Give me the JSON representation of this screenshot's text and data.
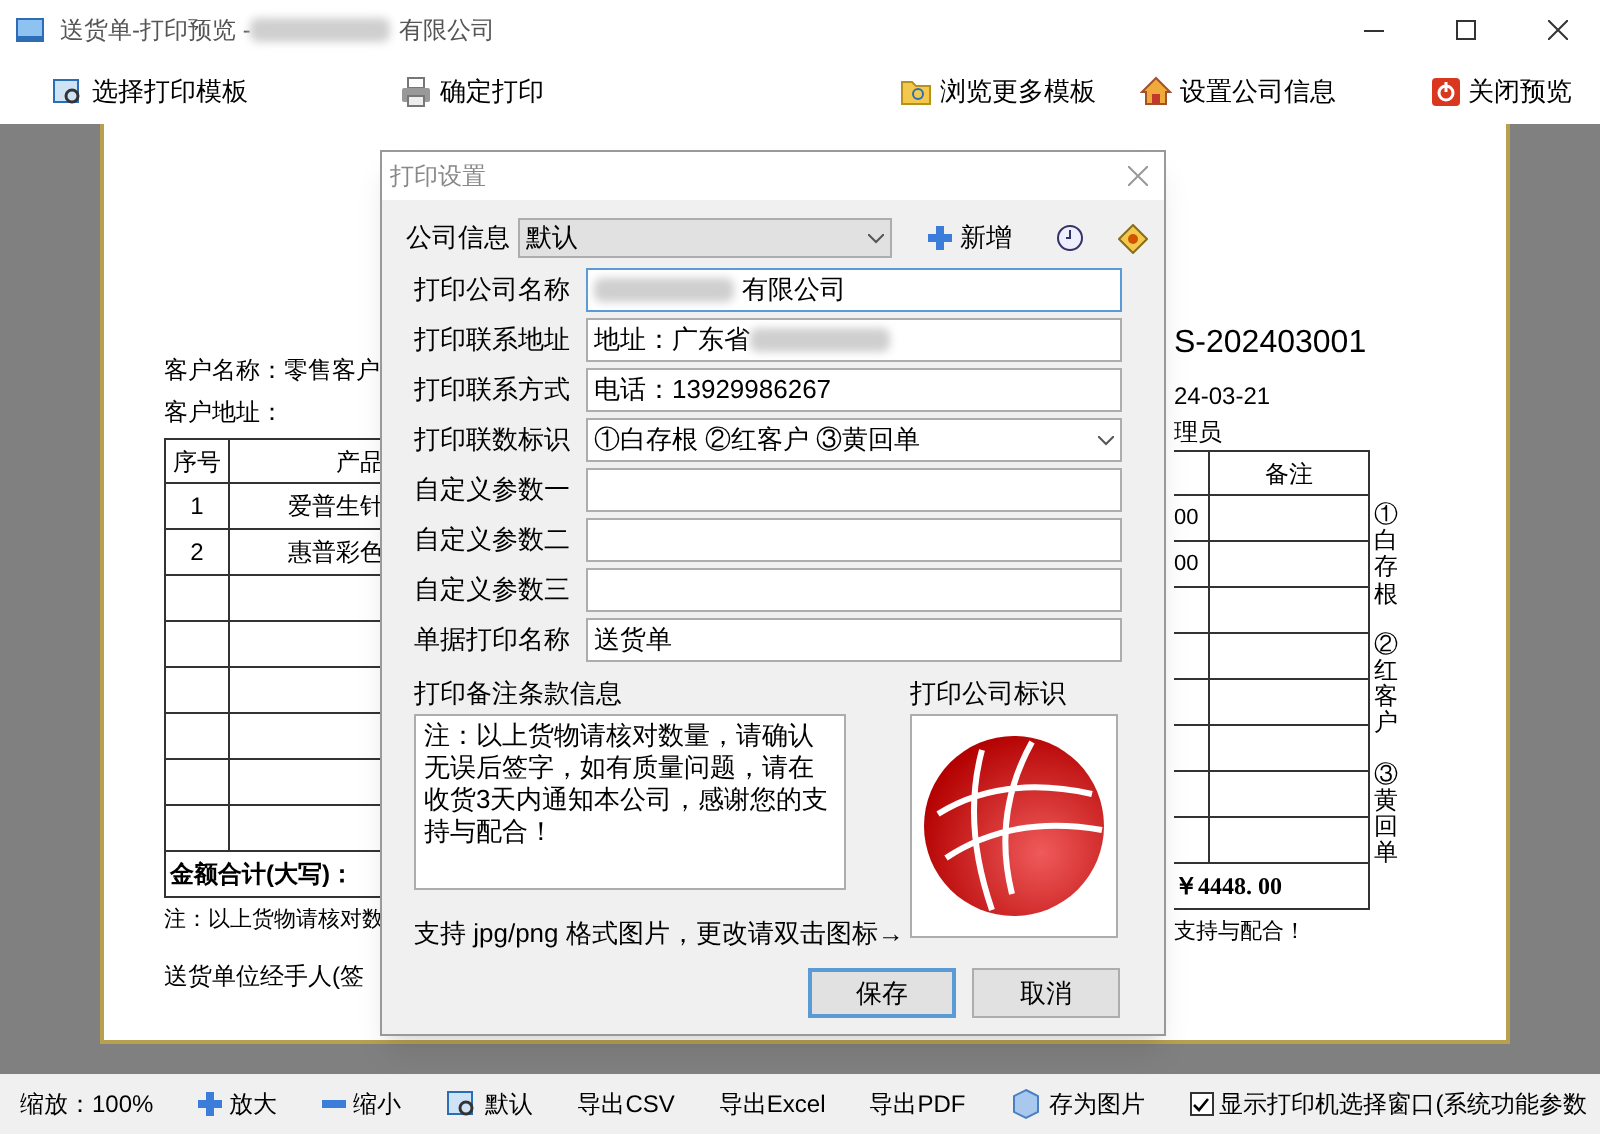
{
  "window": {
    "title": "送货单-打印预览 - ",
    "title_tail": "有限公司"
  },
  "toolbar": [
    {
      "label": "选择打印模板"
    },
    {
      "label": "确定打印"
    },
    {
      "label": "浏览更多模板"
    },
    {
      "label": "设置公司信息"
    },
    {
      "label": "关闭预览"
    }
  ],
  "paper": {
    "customer_name": "客户名称：零售客户",
    "customer_address": "客户地址：",
    "order_no": "S-202403001",
    "date": "24-03-21",
    "handler": "理员",
    "columns": [
      "序号",
      "产品",
      "备注"
    ],
    "rows": [
      {
        "no": "1",
        "product": "爱普生针",
        "amount": "00"
      },
      {
        "no": "2",
        "product": "惠普彩色",
        "amount": "00"
      },
      {},
      {},
      {},
      {},
      {},
      {}
    ],
    "total_label": "金额合计(大写)：",
    "total_value": "￥4448. 00",
    "note_left": "注：以上货物请核对数",
    "note_right": "支持与配合！",
    "signature": "送货单位经手人(签",
    "copies": [
      "①白存根",
      "②红客户",
      "③黄回单"
    ]
  },
  "dialog": {
    "title": "打印设置",
    "company_label": "公司信息",
    "company_select": "默认",
    "add_button": "新增",
    "fields": [
      {
        "label": "打印公司名称",
        "value": "有限公司",
        "blurred": true,
        "focused": true
      },
      {
        "label": "打印联系地址",
        "value": "地址：广东省",
        "blurred": true,
        "focused": false
      },
      {
        "label": "打印联系方式",
        "value": "电话：13929986267",
        "blurred": false,
        "focused": false
      },
      {
        "label": "打印联数标识",
        "value": "①白存根 ②红客户 ③黄回单",
        "blurred": false,
        "focused": false,
        "kind": "select"
      },
      {
        "label": "自定义参数一",
        "blurred": false,
        "focused": false
      },
      {
        "label": "自定义参数二",
        "blurred": false,
        "focused": false
      },
      {
        "label": "自定义参数三",
        "blurred": false,
        "focused": false
      },
      {
        "label": "单据打印名称",
        "value": "送货单",
        "blurred": false,
        "focused": false
      }
    ],
    "remarks_label": "打印备注条款信息",
    "remarks": "注：以上货物请核对数量，请确认无误后签字，如有质量问题，请在收货3天内通知本公司，感谢您的支持与配合！",
    "logo_label": "打印公司标识",
    "hint": "支持 jpg/png 格式图片，更改请双击图标→",
    "save": "保存",
    "cancel": "取消"
  },
  "status_bar": {
    "zoom": "缩放：100%",
    "buttons": [
      {
        "label": "放大"
      },
      {
        "label": "缩小"
      },
      {
        "label": "默认"
      },
      {
        "label": "导出CSV"
      },
      {
        "label": "导出Excel"
      },
      {
        "label": "导出PDF"
      },
      {
        "label": "存为图片"
      }
    ],
    "checkbox": {
      "label": "显示打印机选择窗口(系统功能参数",
      "checked": true
    }
  }
}
